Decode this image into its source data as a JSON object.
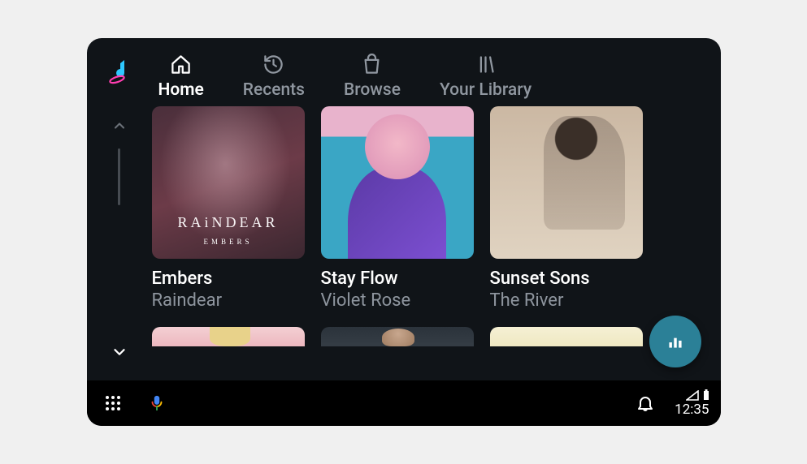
{
  "tabs": [
    {
      "label": "Home",
      "icon": "home-icon"
    },
    {
      "label": "Recents",
      "icon": "recents-icon"
    },
    {
      "label": "Browse",
      "icon": "browse-icon"
    },
    {
      "label": "Your Library",
      "icon": "library-icon"
    }
  ],
  "active_tab": 0,
  "albums": [
    {
      "title": "Embers",
      "artist": "Raindear",
      "cover_main_text": "RAiNDEAR",
      "cover_sub_text": "EMBERS"
    },
    {
      "title": "Stay Flow",
      "artist": "Violet Rose"
    },
    {
      "title": "Sunset Sons",
      "artist": "The River"
    }
  ],
  "navbar": {
    "clock": "12:35"
  },
  "colors": {
    "bg": "#101418",
    "fab": "#2b8097",
    "text_primary": "#ffffff",
    "text_secondary": "#8e959e"
  }
}
